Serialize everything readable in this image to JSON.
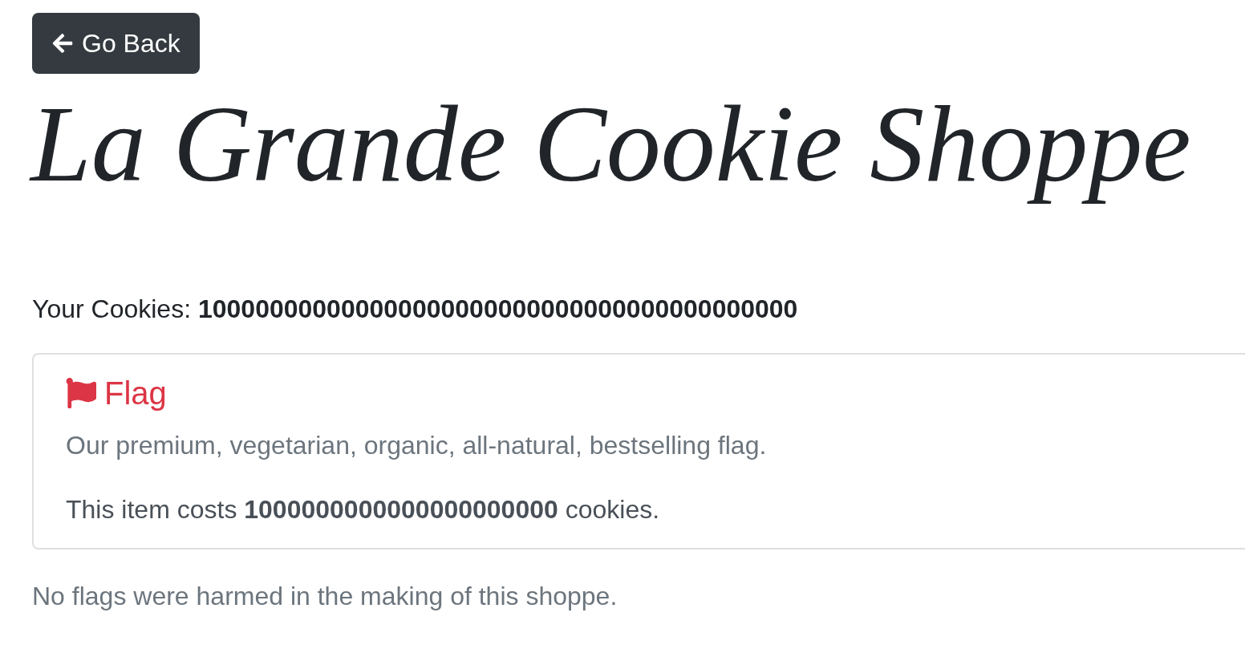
{
  "back_button": {
    "label": "Go Back"
  },
  "title": "La Grande Cookie Shoppe",
  "balance": "Your Cookies: **100000000000000000000000000000000000000000**",
  "items": [
    {
      "name": "Flag",
      "description": "Our premium, vegetarian, organic, all-natural, bestselling flag.",
      "price": "This item costs **1000000000000000000000** cookies."
    }
  ],
  "footer": "No flags were harmed in the making of this shoppe."
}
